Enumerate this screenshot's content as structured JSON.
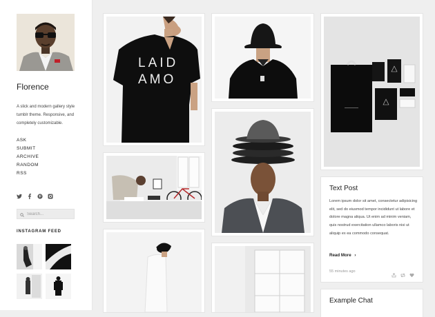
{
  "sidebar": {
    "blog_title": "Florence",
    "description": "A slick and modern gallery style tumblr theme. Responsive, and completely customizable.",
    "nav": [
      "ASK",
      "SUBMIT",
      "ARCHIVE",
      "RANDOM",
      "RSS"
    ],
    "social_icons": [
      "twitter-icon",
      "facebook-icon",
      "pinterest-icon",
      "instagram-icon"
    ],
    "search_placeholder": "Search...",
    "instagram_title": "INSTAGRAM FEED"
  },
  "posts": {
    "text_post": {
      "title": "Text Post",
      "body": "Lorem ipsum dolor sit amet, consectetur adipisicing elit, sed do eiusmod tempor incididunt ut labore et dolore magna aliqua. Ut enim ad minim veniam, quis nostrud exercitation ullamco laboris nisi ut aliquip ex ea commodo consequat.",
      "read_more": "Read More",
      "read_more_arrow": "›",
      "timestamp": "55 minutes ago"
    },
    "chat_post": {
      "title": "Example Chat"
    },
    "shirt_text": {
      "line1": "LAID",
      "line2": "AMO"
    }
  },
  "colors": {
    "page_bg": "#efefef",
    "card_bg": "#ffffff",
    "text": "#222222",
    "muted": "#9a9a9a"
  }
}
